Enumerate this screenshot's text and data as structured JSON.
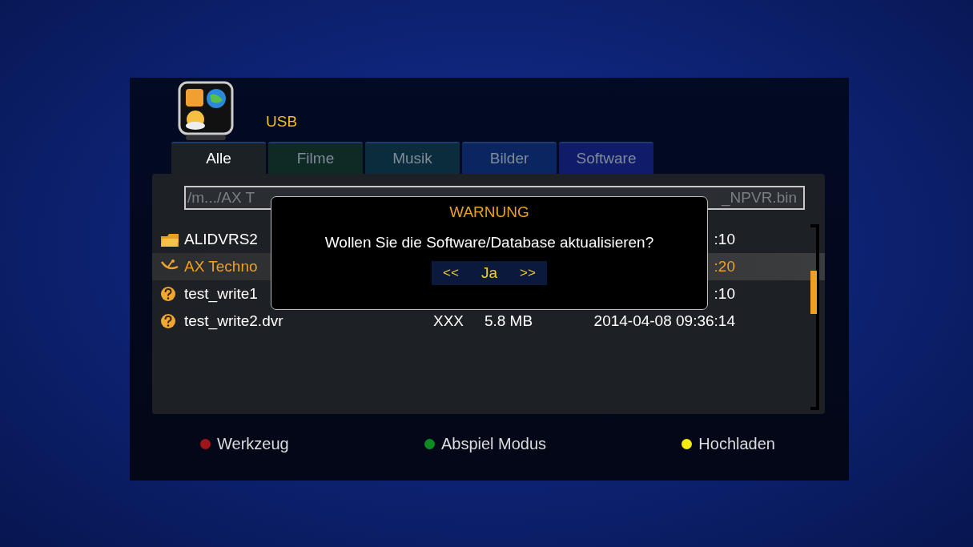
{
  "header": {
    "title": "USB"
  },
  "tabs": [
    {
      "label": "Alle",
      "selected": true,
      "color": "#1c2126"
    },
    {
      "label": "Filme",
      "selected": false,
      "color": "#0d2a24"
    },
    {
      "label": "Musik",
      "selected": false,
      "color": "#0b2c3c"
    },
    {
      "label": "Bilder",
      "selected": false,
      "color": "#0a2560"
    },
    {
      "label": "Software",
      "selected": false,
      "color": "#101c6a"
    }
  ],
  "path": {
    "start": "/m.../AX T",
    "end": "_NPVR.bin"
  },
  "files": [
    {
      "kind": "folder",
      "name": "ALIDVRS2",
      "date": ":10",
      "selected": false
    },
    {
      "kind": "app",
      "name": "AX Techno",
      "date": ":20",
      "selected": true
    },
    {
      "kind": "unknown",
      "name": "test_write1",
      "date": ":10",
      "selected": false
    },
    {
      "kind": "unknown",
      "name": "test_write2.dvr",
      "type": "XXX",
      "size": "5.8 MB",
      "date": "2014-04-08 09:36:14",
      "selected": false
    }
  ],
  "dialog": {
    "title": "WARNUNG",
    "message": "Wollen Sie die Software/Database aktualisieren?",
    "prev": "<<",
    "choice": "Ja",
    "next": ">>"
  },
  "footer": [
    {
      "label": "Werkzeug",
      "color": "#a0141c"
    },
    {
      "label": "Abspiel Modus",
      "color": "#0e8a22"
    },
    {
      "label": "Hochladen",
      "color": "#f2ea10"
    }
  ]
}
